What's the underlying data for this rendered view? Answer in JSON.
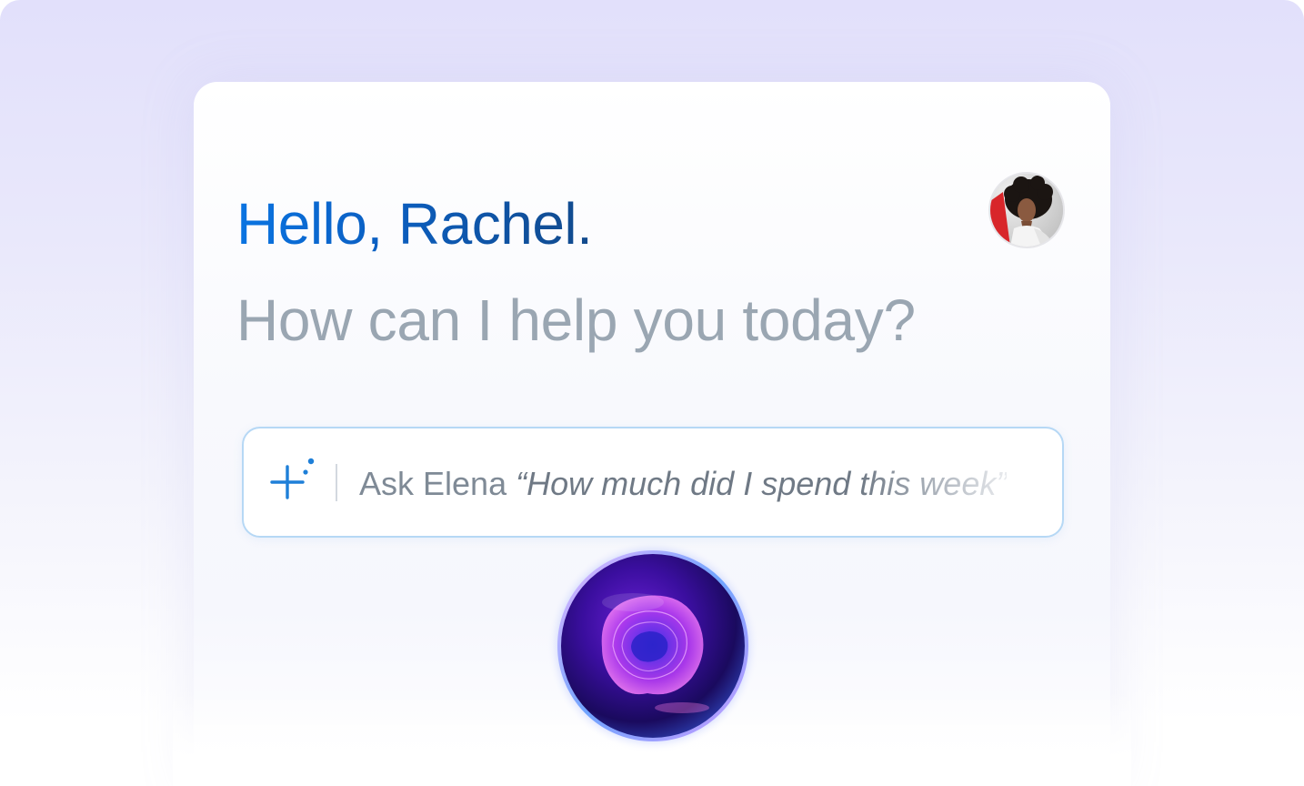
{
  "greeting": {
    "hello": "Hello, Rachel."
  },
  "assistant": {
    "subtitle": "How can I help you today?",
    "prompt_prefix": "Ask Elena",
    "prompt_example": "“How much did I spend this week”"
  },
  "user": {
    "avatar_icon": "user-avatar-photo"
  },
  "icons": {
    "sparkle": "ai-sparkle-plus-icon",
    "orb": "voice-assistant-orb"
  },
  "colors": {
    "accent_blue": "#0a74e2",
    "greeting_dark": "#124a8c",
    "subtitle_gray": "#9aa6b2",
    "input_border": "#b6d8f5",
    "orb_purple": "#7b2fe0",
    "orb_glow": "#5b7cff"
  }
}
